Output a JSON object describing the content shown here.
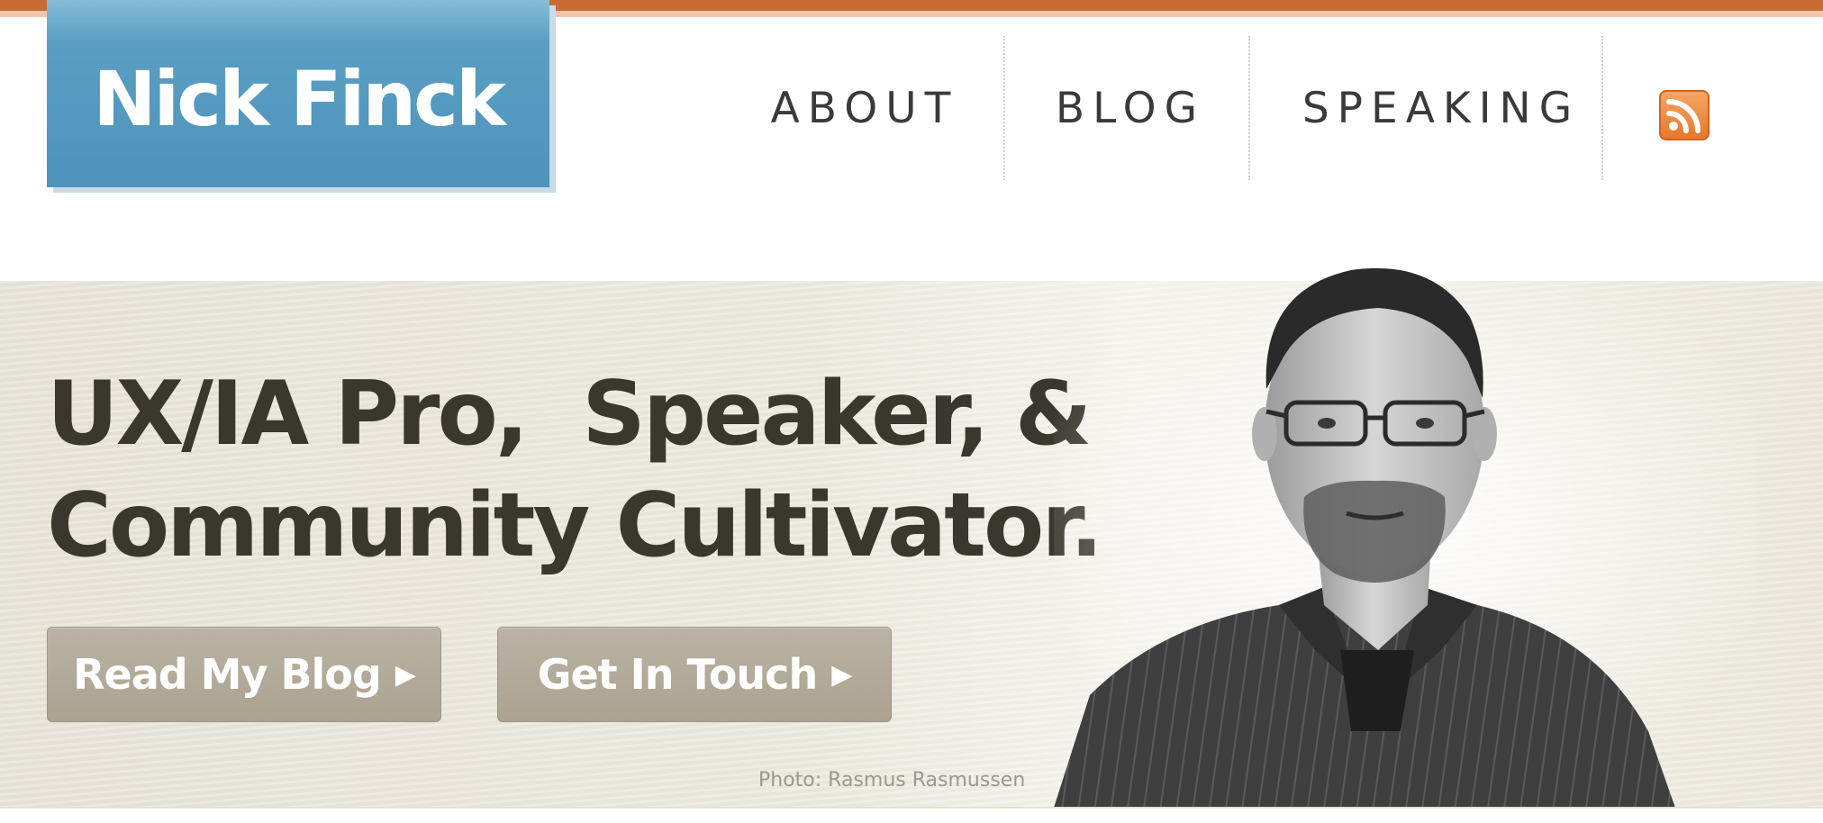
{
  "header": {
    "logo": "Nick Finck",
    "nav": {
      "about": "ABOUT",
      "blog": "BLOG",
      "speaking": "SPEAKING",
      "rss_icon": "rss-feed-icon"
    }
  },
  "hero": {
    "headline_line1": "UX/IA Pro,  Speaker, &",
    "headline_line2": "Community Cultivator.",
    "buttons": {
      "read_blog": "Read My Blog",
      "get_in_touch": "Get In Touch",
      "arrow_icon": "caret-right-icon"
    },
    "photo_credit": "Photo: Rasmus Rasmussen",
    "portrait": "portrait-photo"
  },
  "colors": {
    "accent_orange": "#c96a33",
    "logo_blue": "#4e93bb",
    "hero_bg": "#ece9df",
    "button_bg": "#b3aa9a",
    "headline_text": "#3a382e"
  }
}
